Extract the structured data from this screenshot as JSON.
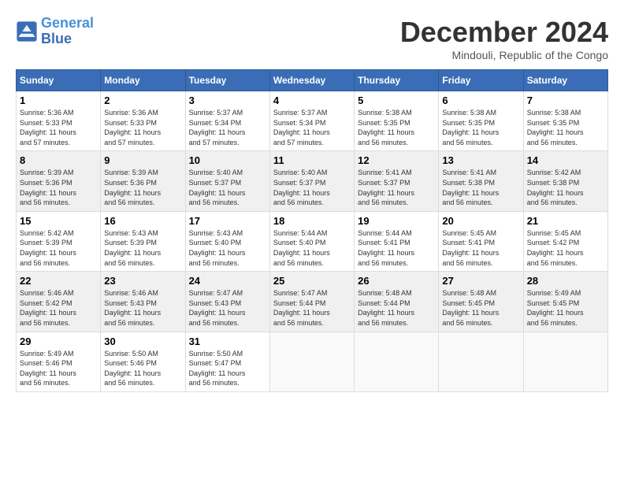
{
  "header": {
    "logo_line1": "General",
    "logo_line2": "Blue",
    "month": "December 2024",
    "location": "Mindouli, Republic of the Congo"
  },
  "weekdays": [
    "Sunday",
    "Monday",
    "Tuesday",
    "Wednesday",
    "Thursday",
    "Friday",
    "Saturday"
  ],
  "weeks": [
    [
      {
        "day": "1",
        "info": "Sunrise: 5:36 AM\nSunset: 5:33 PM\nDaylight: 11 hours\nand 57 minutes."
      },
      {
        "day": "2",
        "info": "Sunrise: 5:36 AM\nSunset: 5:33 PM\nDaylight: 11 hours\nand 57 minutes."
      },
      {
        "day": "3",
        "info": "Sunrise: 5:37 AM\nSunset: 5:34 PM\nDaylight: 11 hours\nand 57 minutes."
      },
      {
        "day": "4",
        "info": "Sunrise: 5:37 AM\nSunset: 5:34 PM\nDaylight: 11 hours\nand 57 minutes."
      },
      {
        "day": "5",
        "info": "Sunrise: 5:38 AM\nSunset: 5:35 PM\nDaylight: 11 hours\nand 56 minutes."
      },
      {
        "day": "6",
        "info": "Sunrise: 5:38 AM\nSunset: 5:35 PM\nDaylight: 11 hours\nand 56 minutes."
      },
      {
        "day": "7",
        "info": "Sunrise: 5:38 AM\nSunset: 5:35 PM\nDaylight: 11 hours\nand 56 minutes."
      }
    ],
    [
      {
        "day": "8",
        "info": "Sunrise: 5:39 AM\nSunset: 5:36 PM\nDaylight: 11 hours\nand 56 minutes."
      },
      {
        "day": "9",
        "info": "Sunrise: 5:39 AM\nSunset: 5:36 PM\nDaylight: 11 hours\nand 56 minutes."
      },
      {
        "day": "10",
        "info": "Sunrise: 5:40 AM\nSunset: 5:37 PM\nDaylight: 11 hours\nand 56 minutes."
      },
      {
        "day": "11",
        "info": "Sunrise: 5:40 AM\nSunset: 5:37 PM\nDaylight: 11 hours\nand 56 minutes."
      },
      {
        "day": "12",
        "info": "Sunrise: 5:41 AM\nSunset: 5:37 PM\nDaylight: 11 hours\nand 56 minutes."
      },
      {
        "day": "13",
        "info": "Sunrise: 5:41 AM\nSunset: 5:38 PM\nDaylight: 11 hours\nand 56 minutes."
      },
      {
        "day": "14",
        "info": "Sunrise: 5:42 AM\nSunset: 5:38 PM\nDaylight: 11 hours\nand 56 minutes."
      }
    ],
    [
      {
        "day": "15",
        "info": "Sunrise: 5:42 AM\nSunset: 5:39 PM\nDaylight: 11 hours\nand 56 minutes."
      },
      {
        "day": "16",
        "info": "Sunrise: 5:43 AM\nSunset: 5:39 PM\nDaylight: 11 hours\nand 56 minutes."
      },
      {
        "day": "17",
        "info": "Sunrise: 5:43 AM\nSunset: 5:40 PM\nDaylight: 11 hours\nand 56 minutes."
      },
      {
        "day": "18",
        "info": "Sunrise: 5:44 AM\nSunset: 5:40 PM\nDaylight: 11 hours\nand 56 minutes."
      },
      {
        "day": "19",
        "info": "Sunrise: 5:44 AM\nSunset: 5:41 PM\nDaylight: 11 hours\nand 56 minutes."
      },
      {
        "day": "20",
        "info": "Sunrise: 5:45 AM\nSunset: 5:41 PM\nDaylight: 11 hours\nand 56 minutes."
      },
      {
        "day": "21",
        "info": "Sunrise: 5:45 AM\nSunset: 5:42 PM\nDaylight: 11 hours\nand 56 minutes."
      }
    ],
    [
      {
        "day": "22",
        "info": "Sunrise: 5:46 AM\nSunset: 5:42 PM\nDaylight: 11 hours\nand 56 minutes."
      },
      {
        "day": "23",
        "info": "Sunrise: 5:46 AM\nSunset: 5:43 PM\nDaylight: 11 hours\nand 56 minutes."
      },
      {
        "day": "24",
        "info": "Sunrise: 5:47 AM\nSunset: 5:43 PM\nDaylight: 11 hours\nand 56 minutes."
      },
      {
        "day": "25",
        "info": "Sunrise: 5:47 AM\nSunset: 5:44 PM\nDaylight: 11 hours\nand 56 minutes."
      },
      {
        "day": "26",
        "info": "Sunrise: 5:48 AM\nSunset: 5:44 PM\nDaylight: 11 hours\nand 56 minutes."
      },
      {
        "day": "27",
        "info": "Sunrise: 5:48 AM\nSunset: 5:45 PM\nDaylight: 11 hours\nand 56 minutes."
      },
      {
        "day": "28",
        "info": "Sunrise: 5:49 AM\nSunset: 5:45 PM\nDaylight: 11 hours\nand 56 minutes."
      }
    ],
    [
      {
        "day": "29",
        "info": "Sunrise: 5:49 AM\nSunset: 5:46 PM\nDaylight: 11 hours\nand 56 minutes."
      },
      {
        "day": "30",
        "info": "Sunrise: 5:50 AM\nSunset: 5:46 PM\nDaylight: 11 hours\nand 56 minutes."
      },
      {
        "day": "31",
        "info": "Sunrise: 5:50 AM\nSunset: 5:47 PM\nDaylight: 11 hours\nand 56 minutes."
      },
      null,
      null,
      null,
      null
    ]
  ]
}
